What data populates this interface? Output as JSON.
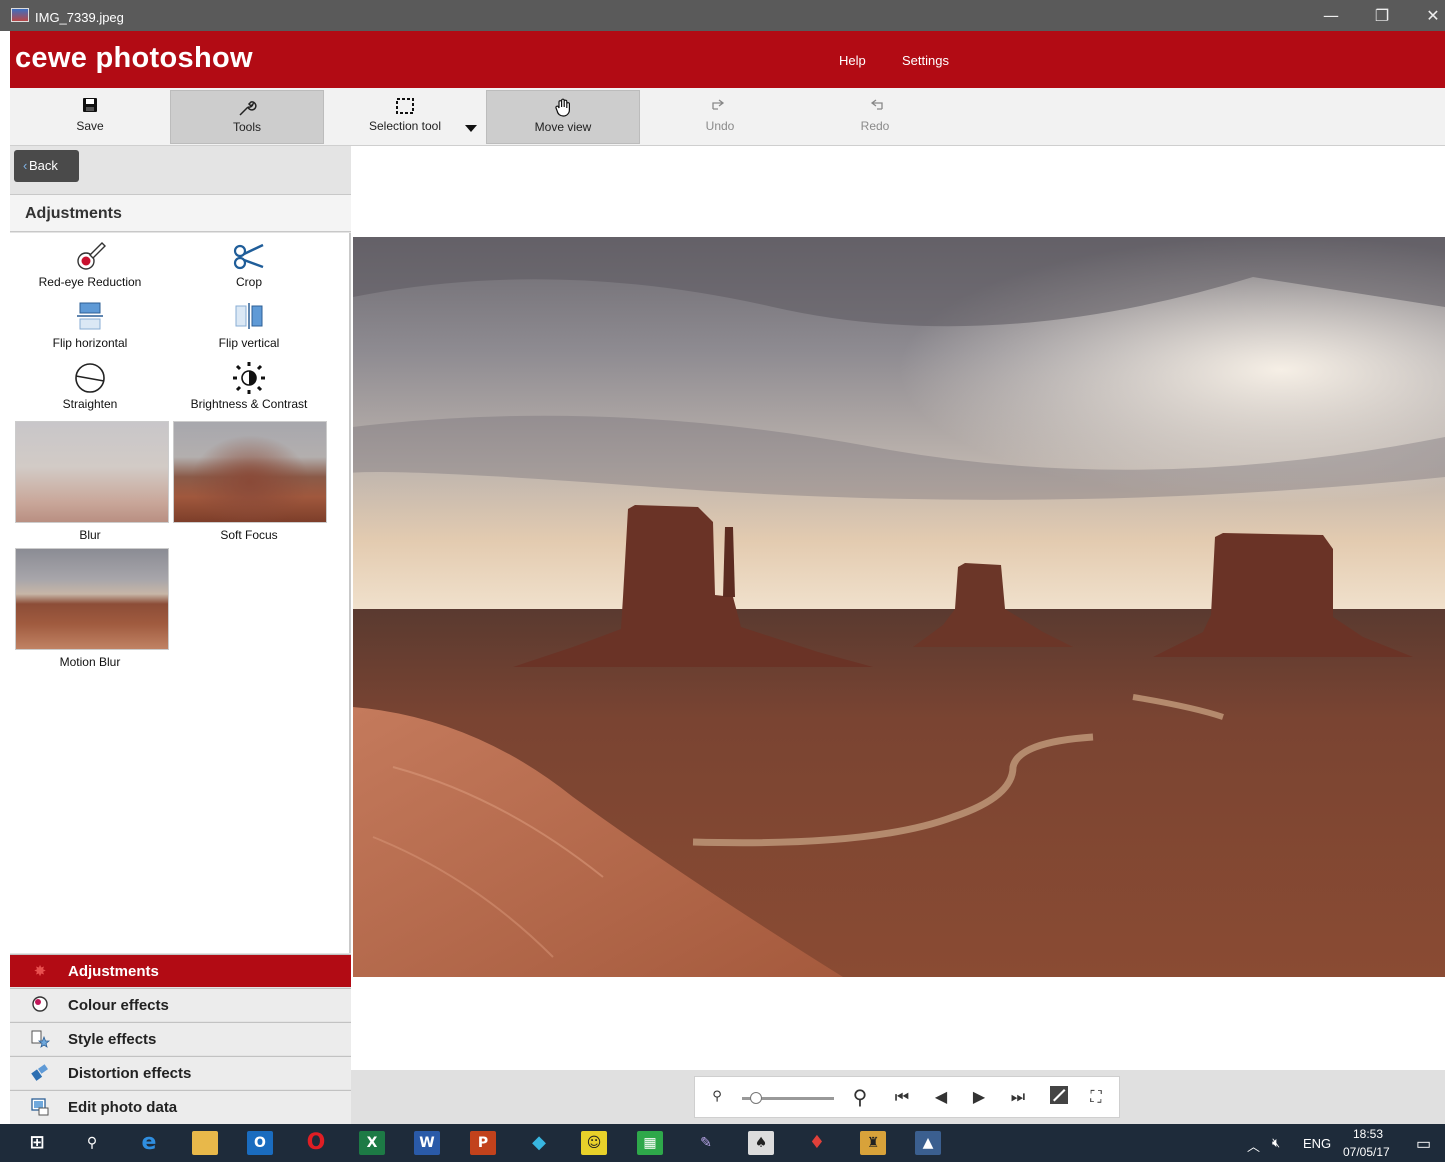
{
  "window": {
    "title": "IMG_7339.jpeg",
    "minimize": "—",
    "restore": "❐",
    "close": "✕"
  },
  "brand": {
    "name": "cewe photoshow",
    "help": "Help",
    "settings": "Settings"
  },
  "toolbar": {
    "save": "Save",
    "tools": "Tools",
    "selection": "Selection tool",
    "move": "Move view",
    "undo": "Undo",
    "redo": "Redo"
  },
  "panel": {
    "back": "Back",
    "heading": "Adjustments",
    "tools": {
      "redeye": "Red-eye Reduction",
      "crop": "Crop",
      "fliph": "Flip horizontal",
      "flipv": "Flip vertical",
      "straighten": "Straighten",
      "brightness": "Brightness & Contrast",
      "blur": "Blur",
      "softfocus": "Soft Focus",
      "motionblur": "Motion Blur"
    },
    "categories": {
      "adjustments": "Adjustments",
      "colour": "Colour effects",
      "style": "Style effects",
      "distortion": "Distortion effects",
      "photodata": "Edit photo data"
    }
  },
  "zoom": {
    "level": 0.15
  },
  "taskbar": {
    "lang": "ENG",
    "time": "18:53",
    "date": "07/05/17"
  }
}
